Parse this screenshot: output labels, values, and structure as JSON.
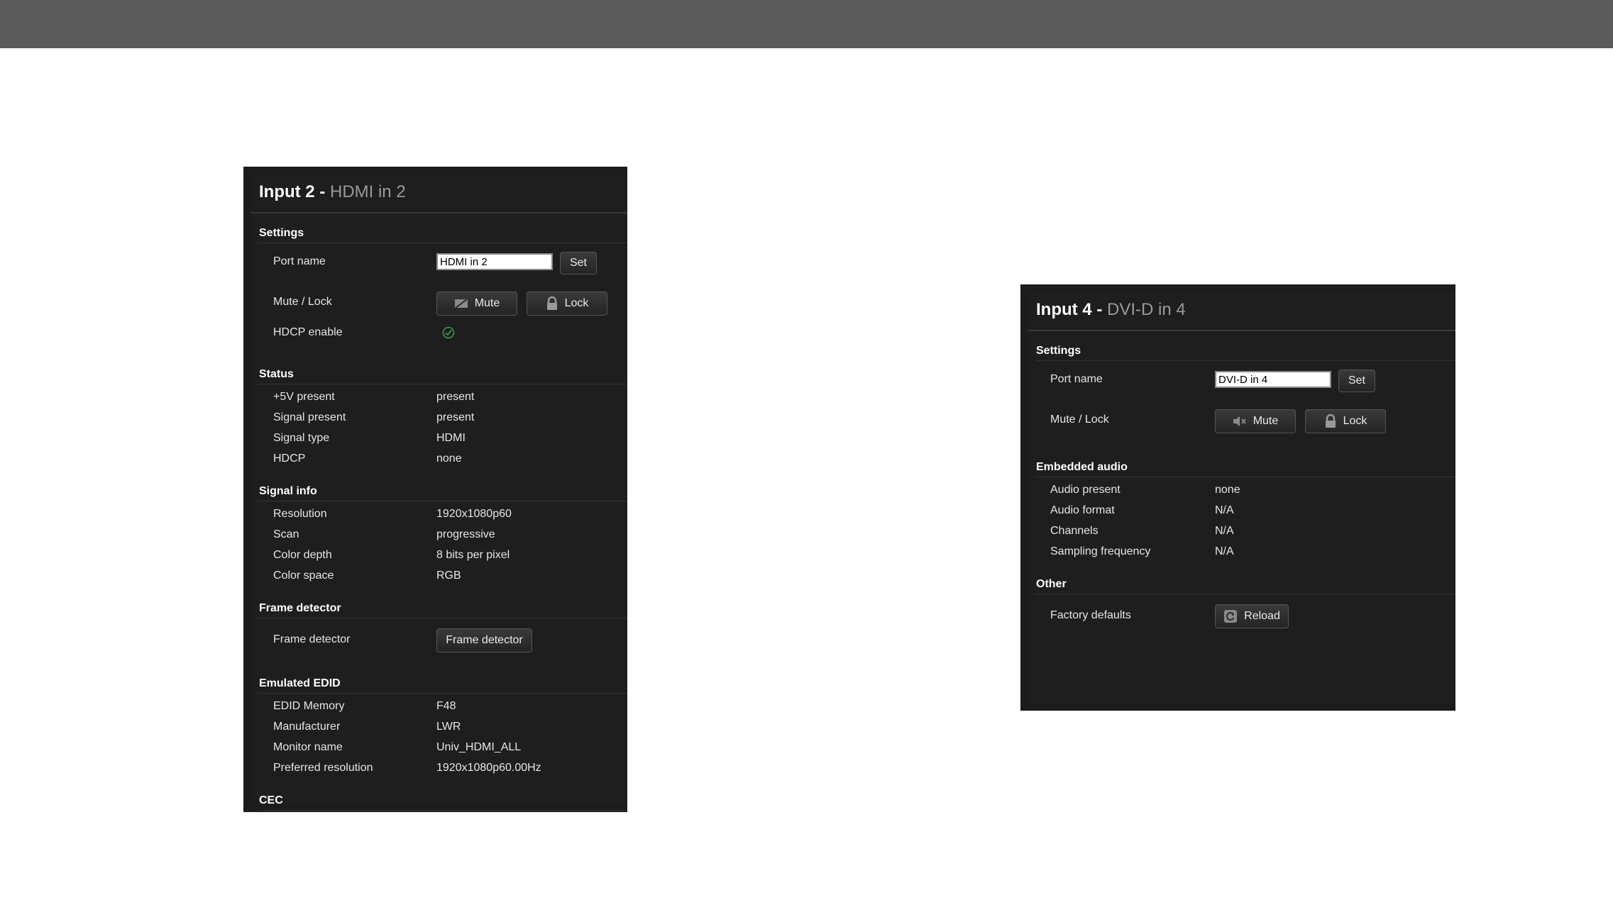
{
  "panels": [
    {
      "title_bold": "Input 2 - ",
      "title_name": "HDMI in 2",
      "settings": {
        "heading": "Settings",
        "port_name_label": "Port name",
        "port_name_value": "HDMI in 2",
        "set_label": "Set",
        "mute_lock_label": "Mute / Lock",
        "mute_label": "Mute",
        "lock_label": "Lock",
        "hdcp_enable_label": "HDCP enable"
      },
      "status": {
        "heading": "Status",
        "rows": [
          {
            "label": "+5V present",
            "value": "present"
          },
          {
            "label": "Signal present",
            "value": "present"
          },
          {
            "label": "Signal type",
            "value": "HDMI"
          },
          {
            "label": "HDCP",
            "value": "none"
          }
        ]
      },
      "signal_info": {
        "heading": "Signal info",
        "rows": [
          {
            "label": "Resolution",
            "value": "1920x1080p60"
          },
          {
            "label": "Scan",
            "value": "progressive"
          },
          {
            "label": "Color depth",
            "value": "8 bits per pixel"
          },
          {
            "label": "Color space",
            "value": "RGB"
          }
        ]
      },
      "frame_detector": {
        "heading": "Frame detector",
        "label": "Frame detector",
        "button": "Frame detector"
      },
      "emulated_edid": {
        "heading": "Emulated EDID",
        "rows": [
          {
            "label": "EDID Memory",
            "value": "F48"
          },
          {
            "label": "Manufacturer",
            "value": "LWR"
          },
          {
            "label": "Monitor name",
            "value": "Univ_HDMI_ALL"
          },
          {
            "label": "Preferred resolution",
            "value": "1920x1080p60.00Hz"
          }
        ]
      },
      "cec": {
        "heading": "CEC"
      }
    },
    {
      "title_bold": "Input 4 - ",
      "title_name": "DVI-D in 4",
      "settings": {
        "heading": "Settings",
        "port_name_label": "Port name",
        "port_name_value": "DVI-D in 4",
        "set_label": "Set",
        "mute_lock_label": "Mute / Lock",
        "mute_label": "Mute",
        "lock_label": "Lock"
      },
      "embedded_audio": {
        "heading": "Embedded audio",
        "rows": [
          {
            "label": "Audio present",
            "value": "none"
          },
          {
            "label": "Audio format",
            "value": "N/A"
          },
          {
            "label": "Channels",
            "value": "N/A"
          },
          {
            "label": "Sampling frequency",
            "value": "N/A"
          }
        ]
      },
      "other": {
        "heading": "Other",
        "factory_defaults_label": "Factory defaults",
        "reload_label": "Reload"
      }
    }
  ],
  "colors": {
    "topbar": "#5a5a5a",
    "panel_bg": "#1c1c1c",
    "title_name": "#9a9a9a",
    "check_green": "#3aa04a"
  },
  "icons": [
    "mute-icon",
    "lock-icon",
    "check-icon",
    "reload-icon"
  ]
}
